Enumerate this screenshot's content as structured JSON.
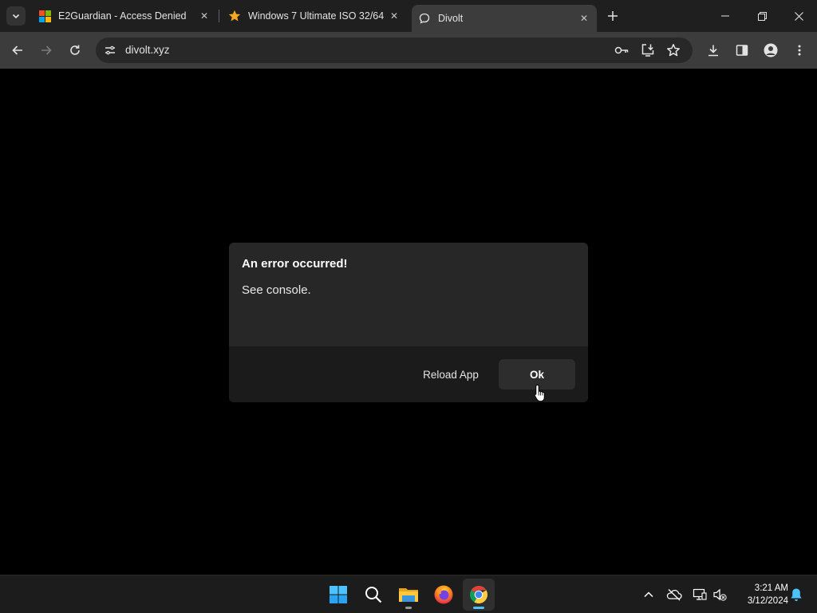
{
  "browser": {
    "tabs": [
      {
        "title": "E2Guardian - Access Denied",
        "favicon": "windows-logo-icon",
        "active": false
      },
      {
        "title": "Windows 7 Ultimate ISO 32/64",
        "favicon": "star-icon",
        "active": false
      },
      {
        "title": "Divolt",
        "favicon": "chat-bubble-icon",
        "active": true
      }
    ],
    "address_bar": {
      "url": "divolt.xyz"
    },
    "colors": {
      "tab_strip": "#1f1f1f",
      "toolbar": "#3c3c3c",
      "omnibox": "#282828"
    }
  },
  "dialog": {
    "title": "An error occurred!",
    "message": "See console.",
    "secondary_button": "Reload App",
    "primary_button": "Ok",
    "colors": {
      "body": "#272727",
      "footer": "#1b1b1b",
      "primary_button": "#2d2d2d"
    }
  },
  "taskbar": {
    "apps": [
      {
        "name": "Start",
        "icon": "windows-start-icon"
      },
      {
        "name": "Search",
        "icon": "search-icon"
      },
      {
        "name": "File Explorer",
        "icon": "folder-icon",
        "running": true
      },
      {
        "name": "Firefox",
        "icon": "firefox-icon"
      },
      {
        "name": "Google Chrome",
        "icon": "chrome-icon",
        "running": true,
        "active": true
      }
    ],
    "tray": {
      "time": "3:21 AM",
      "date": "3/12/2024"
    },
    "colors": {
      "background": "#1c1c1c",
      "active_indicator": "#4cc2ff"
    }
  }
}
